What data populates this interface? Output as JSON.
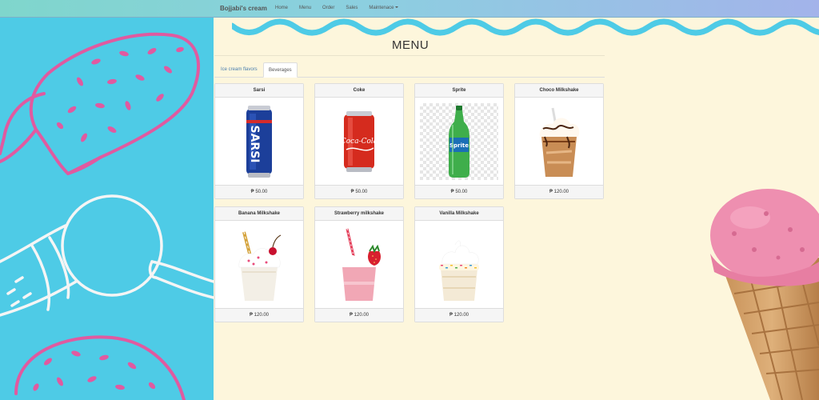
{
  "navbar": {
    "brand": "Bojjabi's cream",
    "items": [
      "Home",
      "Menu",
      "Order",
      "Sales",
      "Maintenace"
    ]
  },
  "page": {
    "title": "MENU"
  },
  "tabs": [
    {
      "label": "Ice cream flavors",
      "active": false
    },
    {
      "label": "Beverages",
      "active": true
    }
  ],
  "products": [
    {
      "name": "Sarsi",
      "price": "₱ 50.00",
      "icon": "sarsi-can"
    },
    {
      "name": "Coke",
      "price": "₱ 50.00",
      "icon": "coke-can"
    },
    {
      "name": "Sprite",
      "price": "₱ 50.00",
      "icon": "sprite-bottle"
    },
    {
      "name": "Choco Milkshake",
      "price": "₱ 120.00",
      "icon": "choco-milkshake"
    },
    {
      "name": "Banana Milkshake",
      "price": "₱ 120.00",
      "icon": "banana-milkshake"
    },
    {
      "name": "Strawberry milkshake",
      "price": "₱ 120.00",
      "icon": "strawberry-milkshake"
    },
    {
      "name": "Vanilla Milkshake",
      "price": "₱ 120.00",
      "icon": "vanilla-milkshake"
    }
  ],
  "colors": {
    "left_panel": "#4ecbe6",
    "background": "#fdf6dc",
    "wave": "#4ecbe6",
    "doodle_pink": "#e05aa0"
  }
}
